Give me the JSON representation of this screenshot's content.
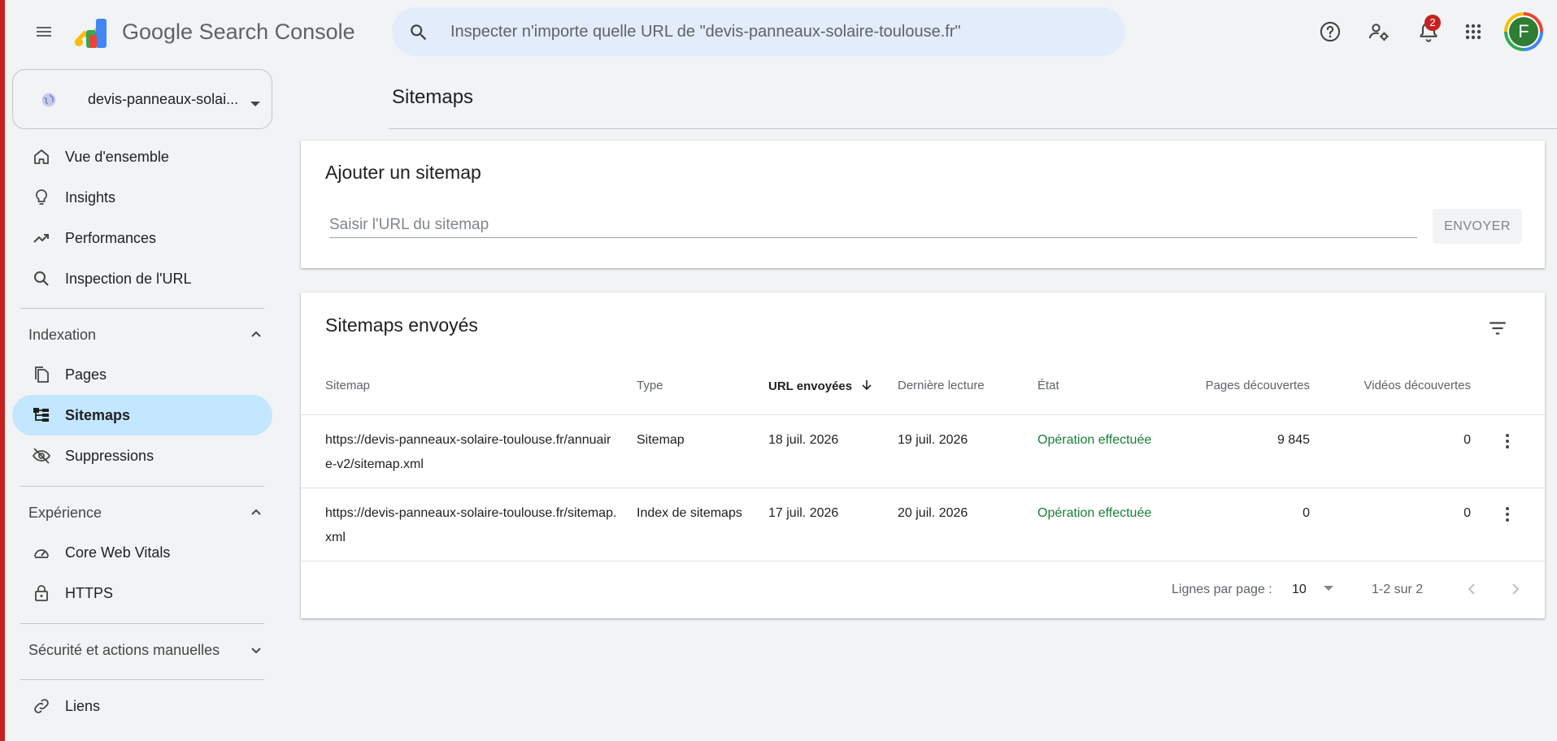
{
  "app": {
    "brand": "Google Search Console",
    "search_placeholder": "Inspecter n'importe quelle URL de \"devis-panneaux-solaire-toulouse.fr\"",
    "notifications_count": "2",
    "avatar_letter": "F"
  },
  "sidebar": {
    "property": "devis-panneaux-solai...",
    "items_top": [
      {
        "label": "Vue d'ensemble",
        "icon": "home-icon"
      },
      {
        "label": "Insights",
        "icon": "lightbulb-icon"
      },
      {
        "label": "Performances",
        "icon": "trending-up-icon"
      },
      {
        "label": "Inspection de l'URL",
        "icon": "search-icon"
      }
    ],
    "sections": [
      {
        "title": "Indexation",
        "items": [
          {
            "label": "Pages",
            "icon": "pages-icon"
          },
          {
            "label": "Sitemaps",
            "icon": "sitemap-icon",
            "active": true
          },
          {
            "label": "Suppressions",
            "icon": "eye-off-icon"
          }
        ]
      },
      {
        "title": "Expérience",
        "items": [
          {
            "label": "Core Web Vitals",
            "icon": "gauge-icon"
          },
          {
            "label": "HTTPS",
            "icon": "lock-icon"
          }
        ]
      },
      {
        "title": "Sécurité et actions manuelles",
        "items": []
      }
    ],
    "items_bottom": [
      {
        "label": "Liens",
        "icon": "link-icon"
      }
    ]
  },
  "main": {
    "page_title": "Sitemaps",
    "add_card": {
      "title": "Ajouter un sitemap",
      "placeholder": "Saisir l'URL du sitemap",
      "submit_label": "ENVOYER"
    },
    "submitted_card": {
      "title": "Sitemaps envoyés",
      "columns": [
        "Sitemap",
        "Type",
        "URL envoyées",
        "Dernière lecture",
        "État",
        "Pages découvertes",
        "Vidéos découvertes"
      ],
      "rows": [
        {
          "sitemap": "https://devis-panneaux-solaire-toulouse.fr/annuaire-v2/sitemap.xml",
          "type": "Sitemap",
          "submitted": "18 juil. 2026",
          "last_read": "19 juil. 2026",
          "state": "Opération effectuée",
          "pages": "9 845",
          "videos": "0"
        },
        {
          "sitemap": "https://devis-panneaux-solaire-toulouse.fr/sitemap.xml",
          "type": "Index de sitemaps",
          "submitted": "17 juil. 2026",
          "last_read": "20 juil. 2026",
          "state": "Opération effectuée",
          "pages": "0",
          "videos": "0"
        }
      ],
      "pagination": {
        "rows_per_page_label": "Lignes par page :",
        "rows_per_page": "10",
        "range": "1-2 sur 2"
      }
    }
  },
  "colors": {
    "active_nav": "#c2e7ff",
    "success": "#188038",
    "search_bg": "#e3ecfa",
    "background": "#f1f3f4"
  }
}
